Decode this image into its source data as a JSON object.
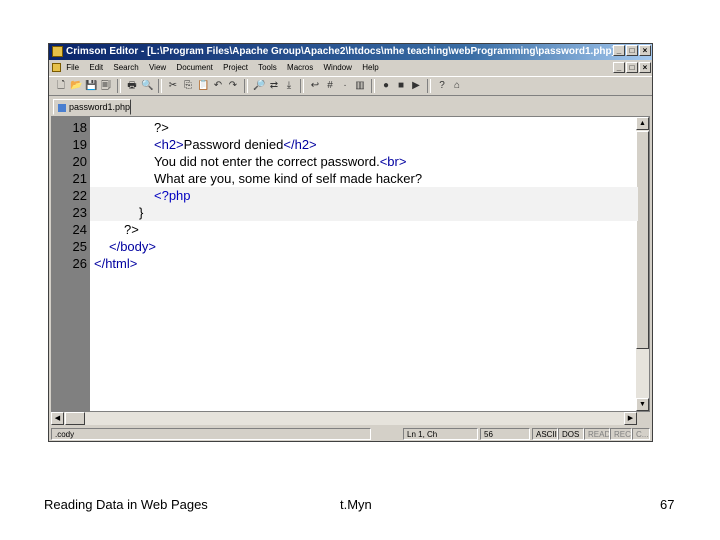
{
  "window": {
    "title": "Crimson Editor - [L:\\Program Files\\Apache Group\\Apache2\\htdocs\\mhe teaching\\webProgramming\\password1.php]",
    "buttons": [
      "_",
      "□",
      "×"
    ]
  },
  "menubar": {
    "items": [
      "File",
      "Edit",
      "Search",
      "View",
      "Document",
      "Project",
      "Tools",
      "Macros",
      "Window",
      "Help"
    ]
  },
  "toolbar": {
    "icons": [
      "new-file-icon",
      "open-icon",
      "save-icon",
      "save-all-icon",
      "print-icon",
      "print-preview-icon",
      "cut-icon",
      "copy-icon",
      "paste-icon",
      "undo-icon",
      "redo-icon",
      "find-icon",
      "replace-icon",
      "goto-icon",
      "word-wrap-icon",
      "line-numbers-icon",
      "spaces-icon",
      "column-icon",
      "record-macro-icon",
      "stop-icon",
      "play-icon",
      "help-icon",
      "home-icon"
    ],
    "glyphs": [
      "🗋",
      "📂",
      "💾",
      "🗐",
      "🖶",
      "🔍",
      "✂",
      "⎘",
      "📋",
      "↶",
      "↷",
      "🔎",
      "⇄",
      "⤓",
      "↩",
      "#",
      "·",
      "▥",
      "●",
      "■",
      "▶",
      "?",
      "⌂"
    ]
  },
  "tabs": [
    {
      "label": "password1.php"
    }
  ],
  "editor": {
    "lines": [
      {
        "num": "18",
        "indent": 4,
        "segments": [
          {
            "text": "?>",
            "cls": "c-txt"
          }
        ],
        "highlight": false
      },
      {
        "num": "19",
        "indent": 4,
        "segments": [
          {
            "text": "<h2>",
            "cls": "c-tag"
          },
          {
            "text": "Password denied",
            "cls": "c-txt"
          },
          {
            "text": "</h2>",
            "cls": "c-tag"
          }
        ],
        "highlight": false
      },
      {
        "num": "20",
        "indent": 4,
        "segments": [
          {
            "text": "You did not enter the correct password.",
            "cls": "c-txt"
          },
          {
            "text": "<br>",
            "cls": "c-tag"
          }
        ],
        "highlight": false
      },
      {
        "num": "21",
        "indent": 4,
        "segments": [
          {
            "text": "What are you, some kind of self made hacker?",
            "cls": "c-txt"
          }
        ],
        "highlight": false
      },
      {
        "num": "22",
        "indent": 4,
        "segments": [
          {
            "text": "<?php",
            "cls": "c-php"
          }
        ],
        "highlight": true
      },
      {
        "num": "23",
        "indent": 3,
        "segments": [
          {
            "text": "}",
            "cls": "c-txt"
          }
        ],
        "highlight": true
      },
      {
        "num": "24",
        "indent": 2,
        "segments": [
          {
            "text": "?>",
            "cls": "c-txt"
          }
        ],
        "highlight": false
      },
      {
        "num": "25",
        "indent": 1,
        "segments": [
          {
            "text": "</body>",
            "cls": "c-tag"
          }
        ],
        "highlight": false
      },
      {
        "num": "26",
        "indent": 0,
        "segments": [
          {
            "text": "</html>",
            "cls": "c-tag"
          }
        ],
        "highlight": false
      }
    ]
  },
  "statusbar": {
    "left": ".cody",
    "position": "Ln 1, Ch",
    "col": "56",
    "encoding": "ASCII",
    "lineend": "DOS",
    "read": "READ",
    "rec": "REC",
    "col2": "C..."
  },
  "footer": {
    "left": "Reading Data in Web Pages",
    "center": "t.Myn",
    "page": "67"
  }
}
